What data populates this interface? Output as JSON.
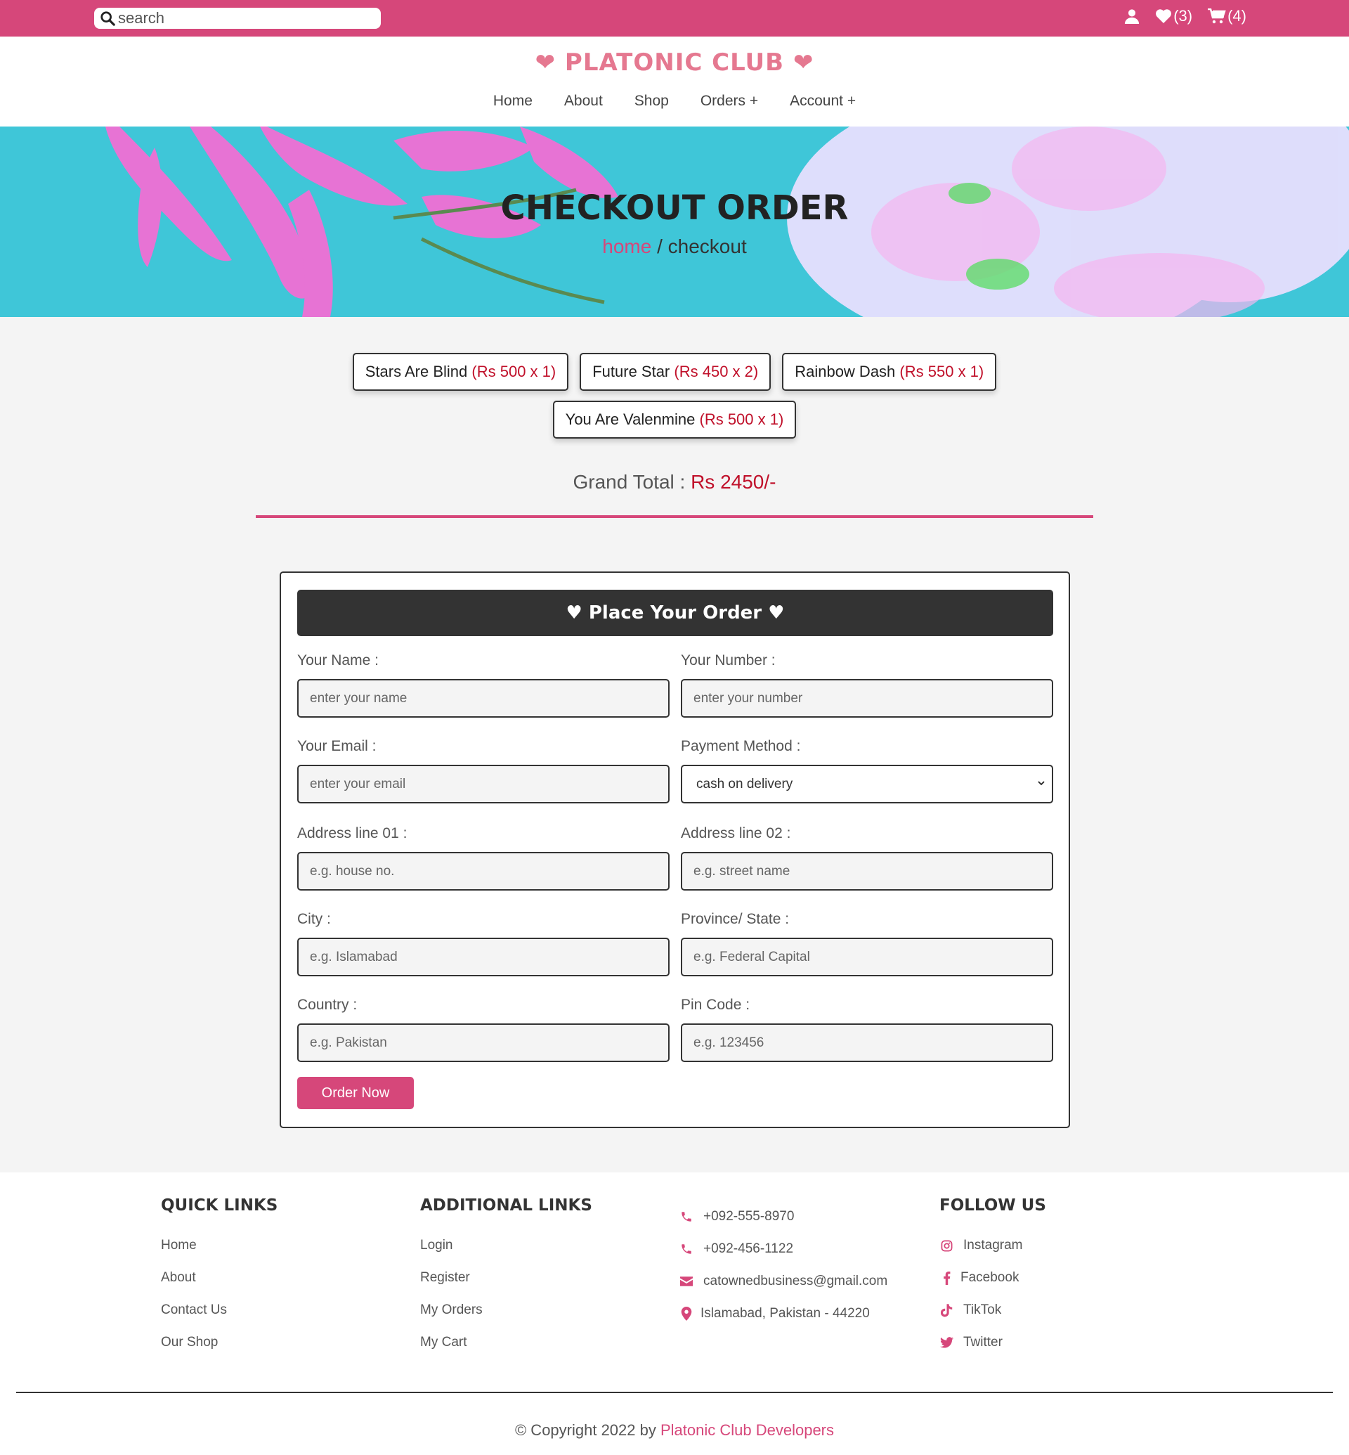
{
  "topbar": {
    "search_placeholder": "search",
    "wishlist_count": "(3)",
    "cart_count": "(4)"
  },
  "header": {
    "logo_text": "PLATONIC CLUB",
    "logo_color": "#e57890",
    "nav": {
      "home": "Home",
      "about": "About",
      "shop": "Shop",
      "orders": "Orders +",
      "account": "Account +"
    }
  },
  "banner": {
    "title": "CHECKOUT ORDER",
    "crumb_home": "home",
    "crumb_sep": " / ",
    "crumb_current": "checkout"
  },
  "order_items": [
    {
      "name": "Stars Are Blind",
      "price": "(Rs 500 x 1)"
    },
    {
      "name": "Future Star",
      "price": "(Rs 450 x 2)"
    },
    {
      "name": "Rainbow Dash",
      "price": "(Rs 550 x 1)"
    },
    {
      "name": "You Are Valenmine",
      "price": "(Rs 500 x 1)"
    }
  ],
  "grand_total": {
    "label": "Grand Total : ",
    "value": "Rs 2450/-"
  },
  "form": {
    "heading": "♥ Place Your Order ♥",
    "fields": {
      "name": {
        "label": "Your Name :",
        "placeholder": "enter your name"
      },
      "number": {
        "label": "Your Number :",
        "placeholder": "enter your number"
      },
      "email": {
        "label": "Your Email :",
        "placeholder": "enter your email"
      },
      "payment": {
        "label": "Payment Method :",
        "selected": "cash on delivery"
      },
      "address1": {
        "label": "Address line 01 :",
        "placeholder": "e.g. house no."
      },
      "address2": {
        "label": "Address line 02 :",
        "placeholder": "e.g. street name"
      },
      "city": {
        "label": "City :",
        "placeholder": "e.g. Islamabad"
      },
      "province": {
        "label": "Province/ State :",
        "placeholder": "e.g. Federal Capital"
      },
      "country": {
        "label": "Country :",
        "placeholder": "e.g. Pakistan"
      },
      "pin": {
        "label": "Pin Code :",
        "placeholder": "e.g. 123456"
      }
    },
    "submit_label": "Order Now"
  },
  "footer": {
    "quick_links": {
      "title": "QUICK LINKS",
      "items": [
        "Home",
        "About",
        "Contact Us",
        "Our Shop"
      ]
    },
    "additional_links": {
      "title": "ADDITIONAL LINKS",
      "items": [
        "Login",
        "Register",
        "My Orders",
        "My Cart"
      ]
    },
    "contact": {
      "phone1": "+092-555-8970",
      "phone2": "+092-456-1122",
      "email": "catownedbusiness@gmail.com",
      "address": "Islamabad, Pakistan - 44220"
    },
    "follow": {
      "title": "FOLLOW US",
      "items": [
        "Instagram",
        "Facebook",
        "TikTok",
        "Twitter"
      ]
    },
    "copyright_prefix": "© Copyright 2022 by ",
    "copyright_owner": "Platonic Club Developers"
  },
  "colors": {
    "brand_pink": "#d6477a",
    "price_red": "#c0102a",
    "dark_panel": "#333333"
  },
  "icons": [
    "search-icon",
    "user-icon",
    "heart-icon",
    "cart-icon",
    "phone-icon",
    "envelope-icon",
    "map-pin-icon",
    "instagram-icon",
    "facebook-icon",
    "tiktok-icon",
    "twitter-icon",
    "chevron-down-icon"
  ]
}
